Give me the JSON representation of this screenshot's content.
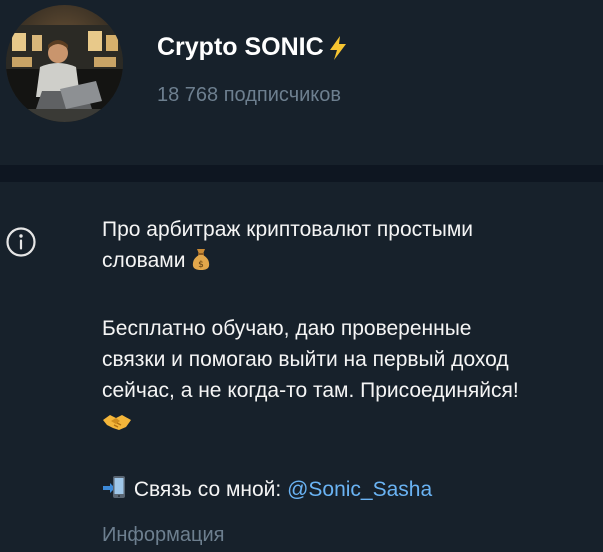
{
  "channel": {
    "name": "Crypto SONIC",
    "name_emoji": "lightning-icon",
    "subscribers": "18 768 подписчиков"
  },
  "bio": {
    "line1": "Про арбитраж криптовалют простыми",
    "line2": "словами",
    "line2_emoji": "money-bag-icon",
    "para2_line1": "Бесплатно обучаю, даю проверенные",
    "para2_line2": "связки и помогаю выйти на первый доход",
    "para2_line3": "сейчас, а не когда-то там. Присоединяйся!",
    "para2_emoji": "handshake-icon",
    "contact_emoji": "mobile-phone-arrow-icon",
    "contact_label": "Связь со мной:",
    "contact_handle": "@Sonic_Sasha"
  },
  "info_label": "Информация",
  "colors": {
    "header_bg": "#17212b",
    "divider_bg": "#0e1621",
    "muted_text": "#6d7f8f",
    "link": "#6ab3f3"
  }
}
